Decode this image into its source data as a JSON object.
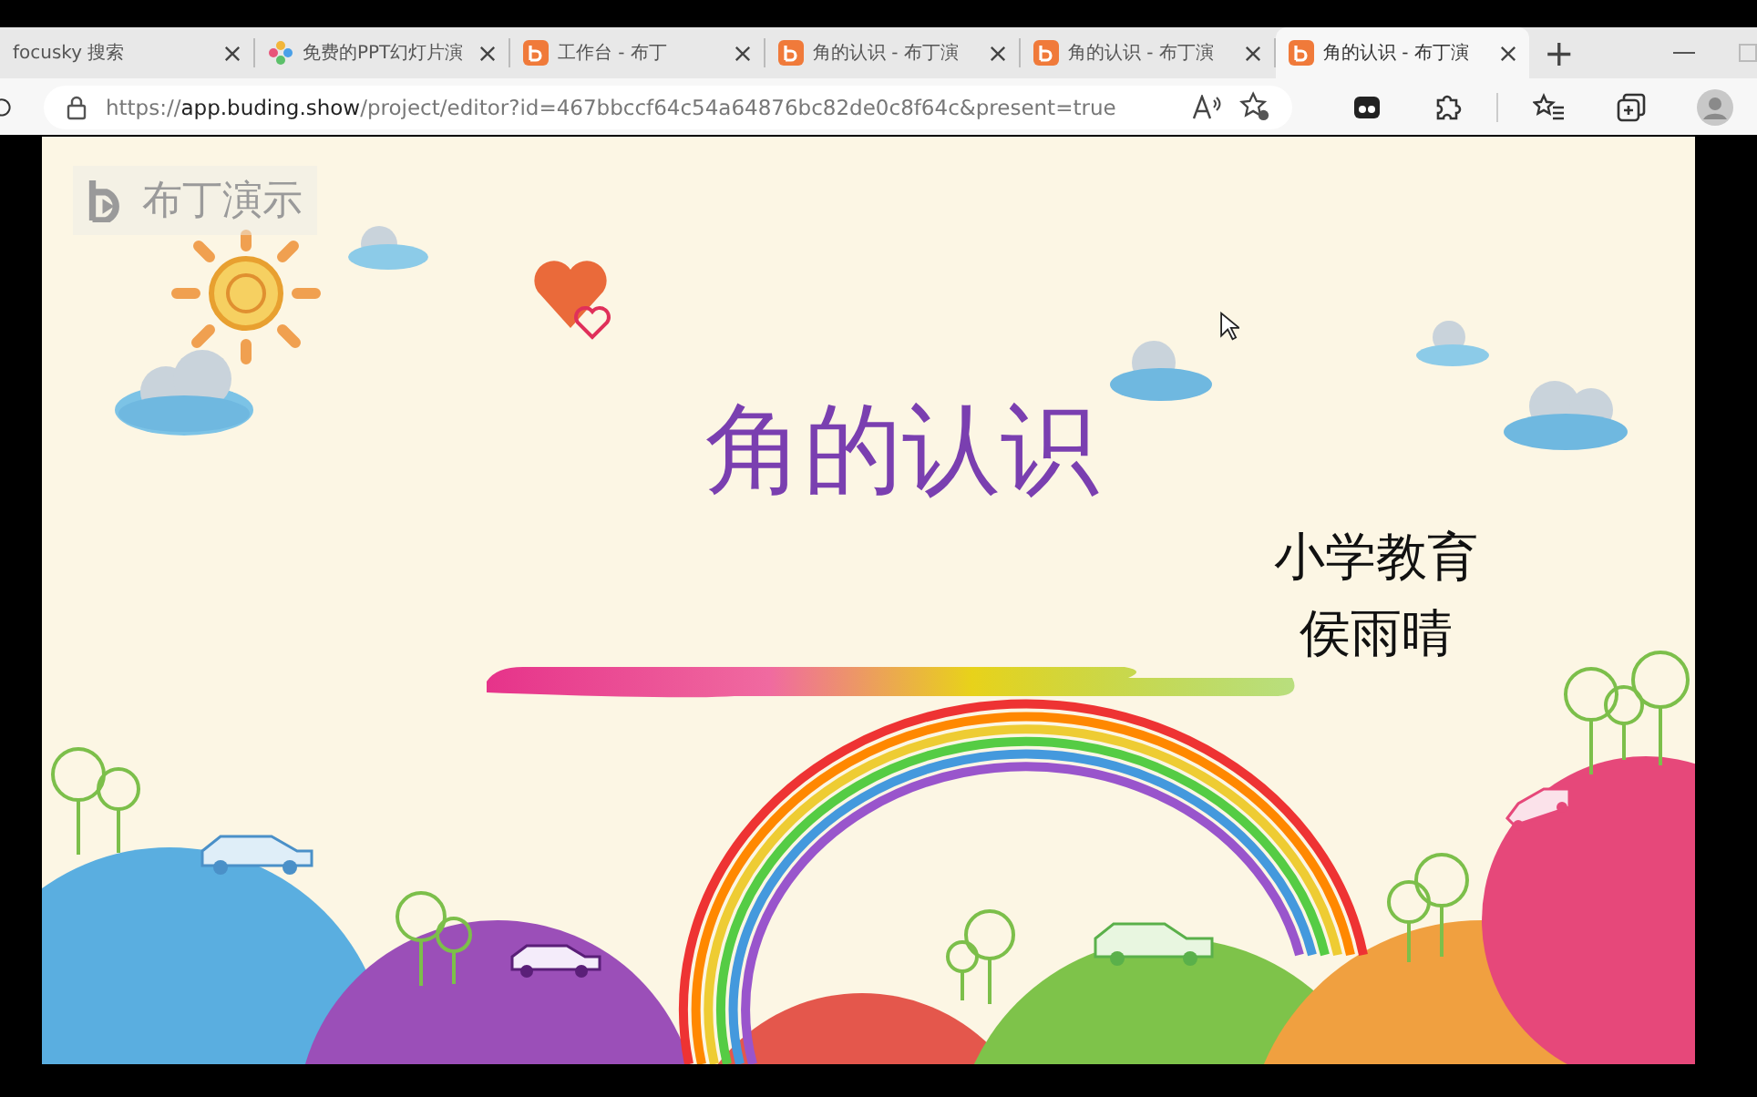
{
  "tabs": [
    {
      "title": "focusky 搜索",
      "kind": "plain",
      "selected": false
    },
    {
      "title": "免费的PPT幻灯片演",
      "kind": "pinwheel",
      "selected": false
    },
    {
      "title": "工作台 - 布丁",
      "kind": "brand",
      "selected": false
    },
    {
      "title": "角的认识 - 布丁演",
      "kind": "brand",
      "selected": false
    },
    {
      "title": "角的认识 - 布丁演",
      "kind": "brand",
      "selected": false
    },
    {
      "title": "角的认识 - 布丁演",
      "kind": "brand",
      "selected": true
    }
  ],
  "new_tab": "+",
  "address": {
    "scheme": "https://",
    "host": "app.buding.show",
    "path": "/project/editor?id=467bbccf64c54a64876bc82de0c8f64c&present=true"
  },
  "slide": {
    "logo": "布丁演示",
    "title": "角的认识",
    "subtitle_lines": [
      "小学教育",
      "侯雨晴"
    ]
  }
}
